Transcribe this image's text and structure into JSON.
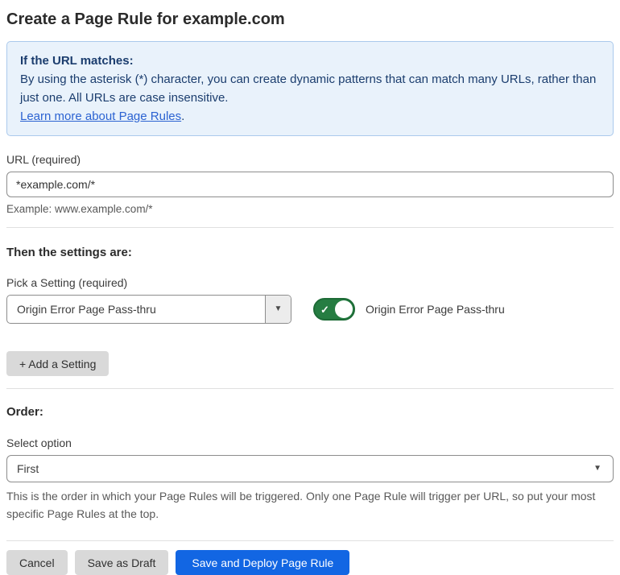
{
  "page": {
    "title": "Create a Page Rule for example.com"
  },
  "info_box": {
    "heading": "If the URL matches:",
    "body": "By using the asterisk (*) character, you can create dynamic patterns that can match many URLs, rather than just one. All URLs are case insensitive.",
    "link_label": "Learn more about Page Rules",
    "link_suffix": "."
  },
  "url_field": {
    "label": "URL (required)",
    "value": "*example.com/*",
    "helper": "Example: www.example.com/*"
  },
  "settings_section": {
    "heading": "Then the settings are:",
    "picker_label": "Pick a Setting (required)",
    "picker_value": "Origin Error Page Pass-thru",
    "picker_arrow_icon": "▼",
    "toggle": {
      "state": "on",
      "check_icon": "✓",
      "label": "Origin Error Page Pass-thru"
    },
    "add_setting_label": "+ Add a Setting"
  },
  "order_section": {
    "heading": "Order:",
    "select_label": "Select option",
    "select_value": "First",
    "select_arrow_icon": "▼",
    "helper": "This is the order in which your Page Rules will be triggered. Only one Page Rule will trigger per URL, so put your most specific Page Rules at the top."
  },
  "footer": {
    "cancel_label": "Cancel",
    "save_draft_label": "Save as Draft",
    "save_deploy_label": "Save and Deploy Page Rule"
  },
  "colors": {
    "accent_blue": "#1266e3",
    "toggle_green": "#267d42",
    "toggle_green_border": "#1d6b36",
    "info_box_bg": "#e9f2fb",
    "info_box_border": "#abc9ec",
    "info_text": "#1b3d6e",
    "link_blue": "#2c63d2"
  }
}
